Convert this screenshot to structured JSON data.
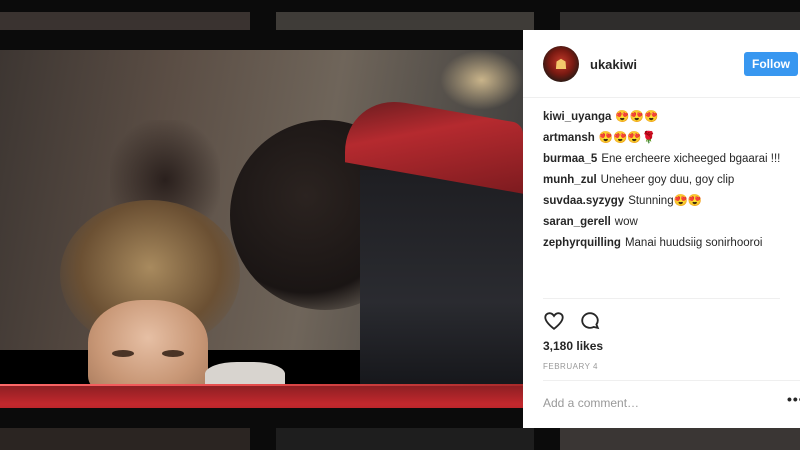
{
  "post": {
    "username": "ukakiwi",
    "follow_label": "Follow",
    "likes": "3,180 likes",
    "date": "FEBRUARY 4",
    "comment_placeholder": "Add a comment…",
    "more_label": "•••"
  },
  "comments": [
    {
      "user": "kiwi_uyanga",
      "text": "😍😍😍"
    },
    {
      "user": "artmansh",
      "text": "😍😍😍🌹"
    },
    {
      "user": "burmaa_5",
      "text": "Ene ercheere xicheeged bgaarai !!!"
    },
    {
      "user": "munh_zul",
      "text": "Uneheer goy duu, goy clip"
    },
    {
      "user": "suvdaa.syzygy",
      "text": "Stunning😍😍"
    },
    {
      "user": "saran_gerell",
      "text": "wow"
    },
    {
      "user": "zephyrquilling",
      "text": "Manai huudsiig sonirhooroi"
    }
  ],
  "colors": {
    "accent": "#3897f0"
  }
}
